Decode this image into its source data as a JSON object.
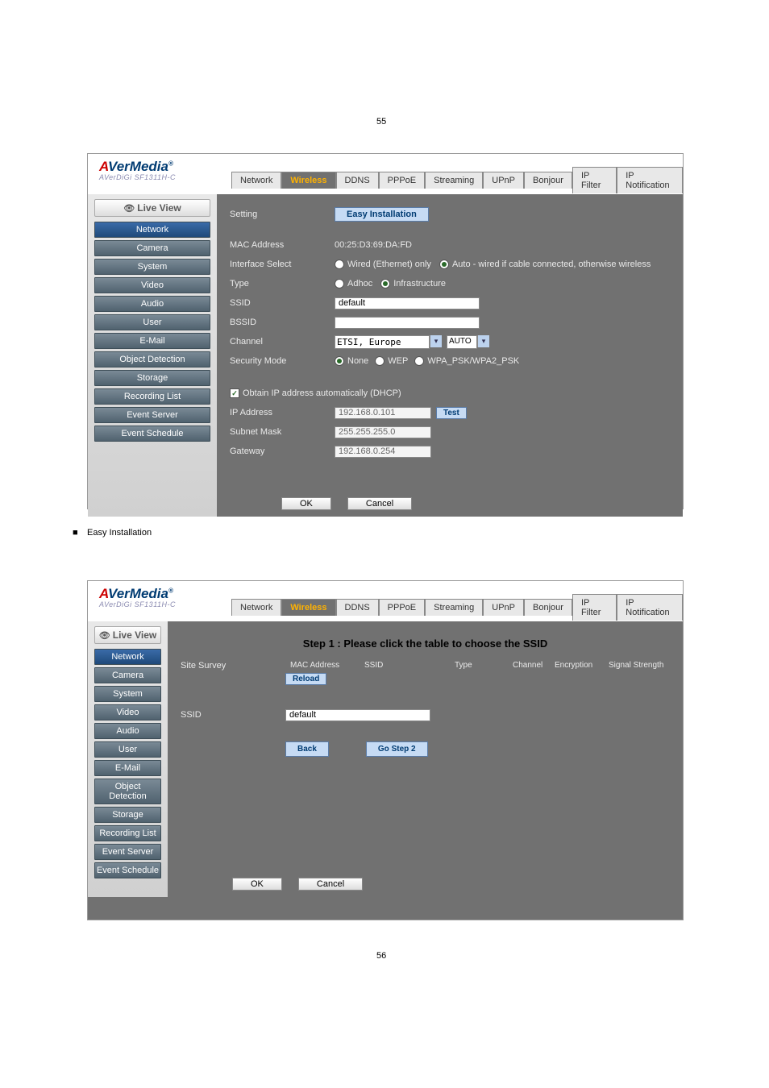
{
  "page_numbers": {
    "top": "55",
    "bottom": "56"
  },
  "brand": {
    "main": "AVerMedia",
    "sup": "®",
    "sub": "AVerDiGi SF1311H-C"
  },
  "tabs": {
    "items": [
      "Network",
      "Wireless",
      "DDNS",
      "PPPoE",
      "Streaming",
      "UPnP",
      "Bonjour",
      "IP Filter",
      "IP Notification"
    ],
    "active": "Wireless"
  },
  "sidebar": {
    "live_view": "Live View",
    "items": [
      "Network",
      "Camera",
      "System",
      "Video",
      "Audio",
      "User",
      "E-Mail",
      "Object Detection",
      "Storage",
      "Recording List",
      "Event Server",
      "Event Schedule"
    ],
    "active": "Network"
  },
  "s1": {
    "setting_label": "Setting",
    "easy_btn": "Easy Installation",
    "mac_label": "MAC Address",
    "mac_value": "00:25:D3:69:DA:FD",
    "iface_label": "Interface Select",
    "iface_opt1": "Wired (Ethernet) only",
    "iface_opt2": "Auto - wired if cable connected, otherwise wireless",
    "type_label": "Type",
    "type_opt1": "Adhoc",
    "type_opt2": "Infrastructure",
    "ssid_label": "SSID",
    "ssid_value": "default",
    "bssid_label": "BSSID",
    "channel_label": "Channel",
    "channel_region": "ETSI, Europe",
    "channel_auto": "AUTO",
    "sec_label": "Security Mode",
    "sec_opt1": "None",
    "sec_opt2": "WEP",
    "sec_opt3": "WPA_PSK/WPA2_PSK",
    "dhcp_label": "Obtain IP address automatically (DHCP)",
    "ip_label": "IP Address",
    "ip_value": "192.168.0.101",
    "test_btn": "Test",
    "mask_label": "Subnet Mask",
    "mask_value": "255.255.255.0",
    "gw_label": "Gateway",
    "gw_value": "192.168.0.254"
  },
  "s2": {
    "step_title": "Step 1 : Please click the table to choose the SSID",
    "survey_label": "Site Survey",
    "th": [
      "MAC Address",
      "SSID",
      "Type",
      "Channel",
      "Encryption",
      "Signal Strength"
    ],
    "reload_btn": "Reload",
    "ssid_label": "SSID",
    "ssid_value": "default",
    "back_btn": "Back",
    "go_btn": "Go Step 2"
  },
  "buttons": {
    "ok": "OK",
    "cancel": "Cancel"
  },
  "note": {
    "text": "Easy Installation"
  }
}
